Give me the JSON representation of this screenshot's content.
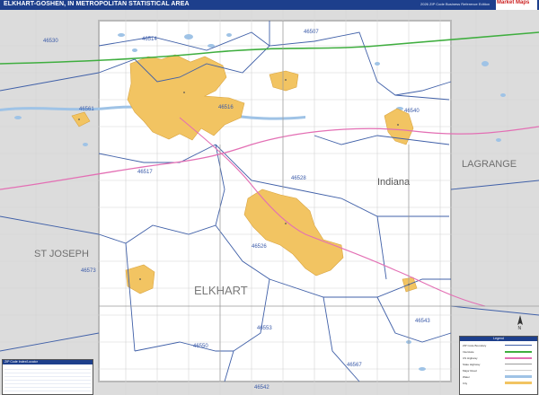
{
  "map": {
    "title": "ELKHART-GOSHEN, IN METROPOLITAN STATISTICAL AREA",
    "edition": "2026 ZIP Code Business Reference Edition",
    "publisher": "Market Maps",
    "state_label": "Indiana",
    "counties": [
      "LAGRANGE",
      "ST JOSEPH",
      "ELKHART"
    ],
    "zip_codes": [
      "46530",
      "46514",
      "46507",
      "46561",
      "46516",
      "46540",
      "46517",
      "46528",
      "46526",
      "46573",
      "46553",
      "46550",
      "46543",
      "46567",
      "46542"
    ],
    "colors": {
      "urban": "#f2c462",
      "urban_stroke": "#d9a441",
      "outside_county": "#dcdcdc",
      "water": "#9fc3e6",
      "zip_boundary": "#4060a8",
      "interstate": "#3fae3f",
      "us_highway": "#e36fb4",
      "title_bar": "#1d3f8c"
    }
  },
  "legend": {
    "title": "Legend",
    "rows": [
      "ZIP Code Boundary",
      "Interstate",
      "US Highway",
      "State Highway",
      "Major Road",
      "Water",
      "City"
    ]
  },
  "locator": {
    "title": "ZIP Code Index/Locator"
  }
}
